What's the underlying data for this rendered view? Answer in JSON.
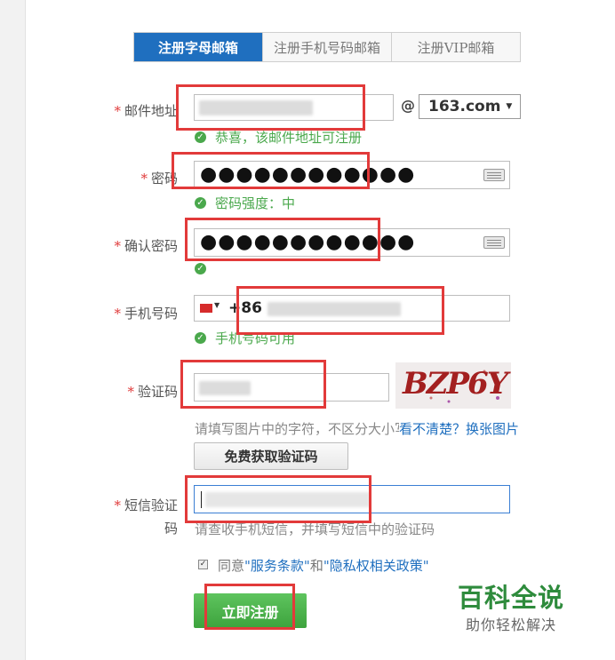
{
  "tabs": [
    {
      "label": "注册字母邮箱",
      "active": true
    },
    {
      "label": "注册手机号码邮箱",
      "active": false
    },
    {
      "label": "注册VIP邮箱",
      "active": false
    }
  ],
  "required_mark": "*",
  "email": {
    "label": "邮件地址",
    "at": "@",
    "domain": "163.com",
    "status": "恭喜，该邮件地址可注册"
  },
  "password": {
    "label": "密码",
    "value": "●●●●●●●●●●●●",
    "strength": "密码强度：中"
  },
  "confirm": {
    "label": "确认密码",
    "value": "●●●●●●●●●●●●"
  },
  "phone": {
    "label": "手机号码",
    "prefix": "+86",
    "status": "手机号码可用"
  },
  "captcha": {
    "label": "验证码",
    "image_text": "BZP6Y",
    "hint": "请填写图片中的字符，不区分大小写",
    "refresh": "看不清楚？换张图片",
    "get_code_button": "免费获取验证码"
  },
  "sms": {
    "label_line1": "短信验证",
    "label_line2": "码",
    "hint": "请查收手机短信，并填写短信中的验证码"
  },
  "agree": {
    "prefix": "同意",
    "terms": "\"服务条款\"",
    "and": "和",
    "privacy": "\"隐私权相关政策\""
  },
  "submit_button": "立即注册",
  "watermark": {
    "title": "百科全说",
    "subtitle": "助你轻松解决"
  }
}
